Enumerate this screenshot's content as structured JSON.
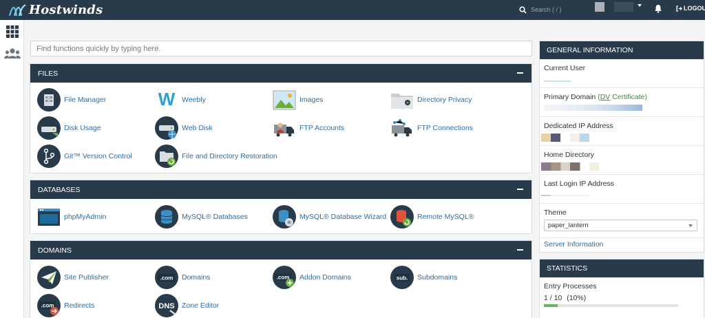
{
  "app": {
    "brand": "Hostwinds",
    "search_placeholder": "Search ( / )",
    "logout_label": "LOGOUT"
  },
  "quickfind": {
    "placeholder": "Find functions quickly by typing here."
  },
  "sections": {
    "files": {
      "title": "FILES",
      "items": [
        "File Manager",
        "Weebly",
        "Images",
        "Directory Privacy",
        "Disk Usage",
        "Web Disk",
        "FTP Accounts",
        "FTP Connections",
        "Git™ Version Control",
        "File and Directory Restoration"
      ]
    },
    "databases": {
      "title": "DATABASES",
      "items": [
        "phpMyAdmin",
        "MySQL® Databases",
        "MySQL® Database Wizard",
        "Remote MySQL®"
      ]
    },
    "domains": {
      "title": "DOMAINS",
      "items": [
        "Site Publisher",
        "Domains",
        "Addon Domains",
        "Subdomains",
        "Redirects",
        "Zone Editor"
      ]
    }
  },
  "general_info": {
    "title": "GENERAL INFORMATION",
    "current_user": "Current User",
    "primary_domain": "Primary Domain",
    "dv_open": "(",
    "dv_abbr": "DV",
    "dv_rest": " Certificate)",
    "dedicated_ip": "Dedicated IP Address",
    "home_directory": "Home Directory",
    "last_login_ip": "Last Login IP Address",
    "theme_label": "Theme",
    "theme_value": "paper_lantern",
    "server_info": "Server Information"
  },
  "statistics": {
    "title": "STATISTICS",
    "entry_processes": "Entry Processes",
    "entry_value": "1 / 10",
    "entry_percent": "(10%)",
    "entry_fraction": 0.1
  },
  "icons": {
    "weebly": "W",
    "com": ".com",
    "sub": "sub.",
    "dns": "DNS"
  },
  "colors": {
    "header": "#293a4a",
    "link": "#2d6ea6",
    "accent_green": "#5cb85c"
  }
}
